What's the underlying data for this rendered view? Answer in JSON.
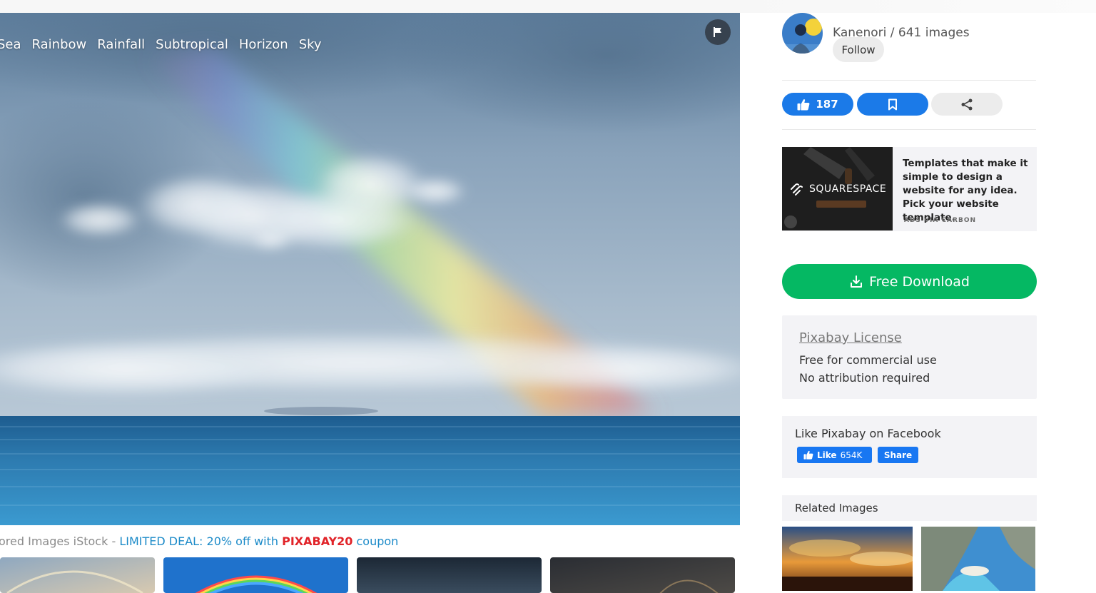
{
  "tags": [
    "Sea",
    "Rainbow",
    "Rainfall",
    "Subtropical",
    "Horizon",
    "Sky"
  ],
  "icons": {
    "flag": "flag-icon",
    "like": "thumbs-up-icon",
    "save": "bookmark-icon",
    "share": "share-icon",
    "download": "download-icon"
  },
  "sponsored": {
    "prefix": "ored Images iStock - ",
    "deal": "LIMITED DEAL: 20% off with ",
    "code": "PIXABAY20",
    "suffix": " coupon"
  },
  "author": {
    "name": "Kanenori / 641 images",
    "follow_label": "Follow"
  },
  "actions": {
    "like_count": "187"
  },
  "ad": {
    "brand": "SQUARESPACE",
    "text": "Templates that make it simple to design a website for any idea. Pick your website template.",
    "via": "ADS VIA CARBON"
  },
  "download": {
    "label": "Free Download"
  },
  "license": {
    "title": "Pixabay License",
    "line1": "Free for commercial use",
    "line2": "No attribution required"
  },
  "facebook": {
    "title": "Like Pixabay on Facebook",
    "like_label": "Like",
    "like_count": "654K",
    "share_label": "Share"
  },
  "related": {
    "title": "Related Images"
  },
  "colors": {
    "accent_blue": "#1b7ae8",
    "download_green": "#05b863",
    "coupon_red": "#e12328",
    "deal_blue": "#1b8ac8"
  }
}
